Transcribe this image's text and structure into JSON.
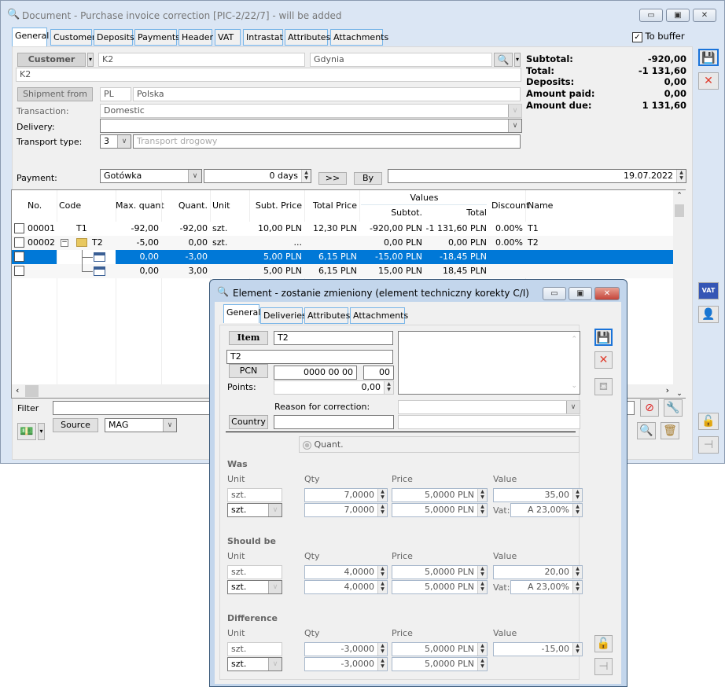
{
  "main": {
    "title": "Document - Purchase invoice correction [PIC-2/22/7]  - will be added",
    "tabs": [
      "General",
      "Customer",
      "Deposits",
      "Payments",
      "Header",
      "VAT",
      "Intrastat",
      "Attributes",
      "Attachments"
    ],
    "to_buffer": {
      "label": "To buffer",
      "checked": true
    },
    "customer_button": "Customer",
    "customer_code": "K2",
    "customer_city": "Gdynia",
    "customer_name": "K2",
    "shipment_button": "Shipment from",
    "shipment_code": "PL",
    "shipment_country": "Polska",
    "transaction_label": "Transaction:",
    "transaction_value": "Domestic",
    "delivery_label": "Delivery:",
    "delivery_value": "",
    "transport_label": "Transport type:",
    "transport_code": "3",
    "transport_placeholder": "Transport drogowy",
    "payment_label": "Payment:",
    "payment_value": "Gotówka",
    "payment_days": "0 days",
    "arrow_button": ">>",
    "by_button": "By",
    "payment_date": "19.07.2022",
    "summary": [
      {
        "label": "Subtotal:",
        "value": "-920,00"
      },
      {
        "label": "Total:",
        "value": "-1 131,60"
      },
      {
        "label": "Deposits:",
        "value": "0,00"
      },
      {
        "label": "Amount paid:",
        "value": "0,00"
      },
      {
        "label": "Amount due:",
        "value": "1 131,60"
      }
    ],
    "grid": {
      "headers": {
        "no": "No.",
        "code": "Code",
        "max": "Max. quant",
        "quant": "Quant.",
        "unit": "Unit",
        "subt_price": "Subt. Price",
        "total_price": "Total Price",
        "values": "Values",
        "subtot": "Subtot.",
        "total": "Total",
        "discount": "Discount",
        "name": "Name"
      },
      "rows": [
        {
          "no": "00001",
          "code": "T1",
          "max": "-92,00",
          "quant": "-92,00",
          "unit": "szt.",
          "subt_price": "10,00 PLN",
          "total_price": "12,30 PLN",
          "subtot": "-920,00 PLN",
          "total": "-1 131,60 PLN",
          "discount": "0.00%",
          "name": "T1"
        },
        {
          "no": "00002",
          "code": "T2",
          "max": "-5,00",
          "quant": "0,00",
          "unit": "szt.",
          "subt_price": "...",
          "total_price": "",
          "subtot": "0,00 PLN",
          "total": "0,00 PLN",
          "discount": "0.00%",
          "name": "T2"
        },
        {
          "no": "",
          "code": "",
          "max": "0,00",
          "quant": "-3,00",
          "unit": "",
          "subt_price": "5,00 PLN",
          "total_price": "6,15 PLN",
          "subtot": "-15,00 PLN",
          "total": "-18,45 PLN",
          "discount": "",
          "name": "",
          "selected": true
        },
        {
          "no": "",
          "code": "",
          "max": "0,00",
          "quant": "3,00",
          "unit": "",
          "subt_price": "5,00 PLN",
          "total_price": "6,15 PLN",
          "subtot": "15,00 PLN",
          "total": "18,45 PLN",
          "discount": "",
          "name": ""
        }
      ]
    },
    "filter_label": "Filter",
    "filter_value": "",
    "source_button": "Source",
    "source_value": "MAG"
  },
  "dialog": {
    "title": "Element - zostanie zmieniony (element techniczny korekty C/I)",
    "tabs": [
      "General",
      "Deliveries",
      "Attributes",
      "Attachments"
    ],
    "item_button": "Item",
    "item_code": "T2",
    "item_name": "T2",
    "pcn_button": "PCN",
    "pcn_code": "0000 00 00",
    "pcn_suffix": "00",
    "points_label": "Points:",
    "points_value": "0,00",
    "reason_label": "Reason for correction:",
    "reason_value": "",
    "country_button": "Country",
    "country_value": "",
    "quant_radio": "Quant.",
    "col_unit": "Unit",
    "col_qty": "Qty",
    "col_price": "Price",
    "col_value": "Value",
    "vat_label": "Vat:",
    "sections": [
      {
        "title": "Was",
        "unit1": "szt.",
        "unit2": "szt.",
        "qty1": "7,0000",
        "qty2": "7,0000",
        "price1": "5,0000 PLN",
        "price2": "5,0000 PLN",
        "value": "35,00",
        "vat": "A 23,00%"
      },
      {
        "title": "Should be",
        "unit1": "szt.",
        "unit2": "szt.",
        "qty1": "4,0000",
        "qty2": "4,0000",
        "price1": "5,0000 PLN",
        "price2": "5,0000 PLN",
        "value": "20,00",
        "vat": "A 23,00%"
      },
      {
        "title": "Difference",
        "unit1": "szt.",
        "unit2": "szt.",
        "qty1": "-3,0000",
        "qty2": "-3,0000",
        "price1": "5,0000 PLN",
        "price2": "5,0000 PLN",
        "value": "-15,00"
      }
    ]
  },
  "colors": {
    "selection": "#0078d7",
    "tab_border": "#7ab6e8",
    "close_red": "#e03a2a"
  }
}
